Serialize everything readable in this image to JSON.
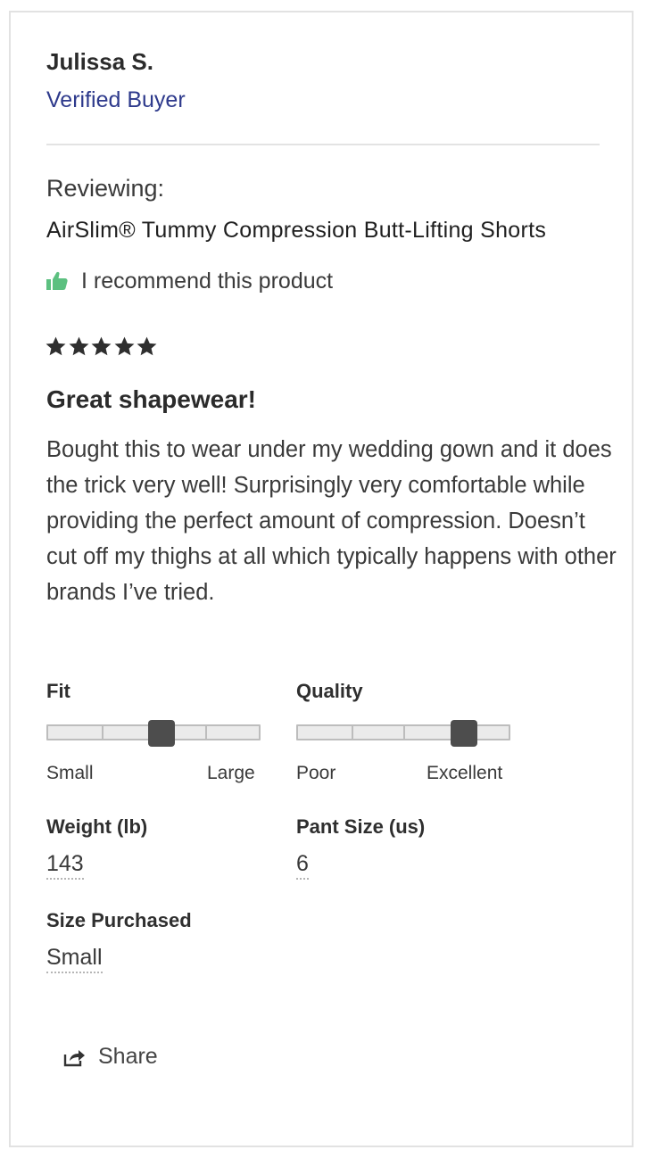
{
  "reviewer": {
    "name": "Julissa S.",
    "badge": "Verified Buyer"
  },
  "product": {
    "reviewing_label": "Reviewing:",
    "name": "AirSlim® Tummy Compression Butt-Lifting Shorts"
  },
  "recommend": {
    "icon": "thumbs-up-icon",
    "text": "I recommend this product",
    "icon_color": "#5cc080"
  },
  "rating": {
    "value": 5,
    "max": 5
  },
  "review": {
    "title": "Great shapewear!",
    "body": "Bought this to wear under my wedding gown and it does the trick very well! Surprisingly very comfortable while providing the perfect amount of compression. Doesn’t cut off my thighs at all which typically happens with other brands I’ve tried."
  },
  "fit": {
    "label": "Fit",
    "min_label": "Small",
    "max_label": "Large",
    "value_fraction": 0.54
  },
  "quality": {
    "label": "Quality",
    "min_label": "Poor",
    "max_label": "Excellent",
    "value_fraction": 0.79
  },
  "weight": {
    "label": "Weight (lb)",
    "value": "143"
  },
  "pant_size": {
    "label": "Pant Size (us)",
    "value": "6"
  },
  "size_purchased": {
    "label": "Size Purchased",
    "value": "Small"
  },
  "share": {
    "icon": "share-icon",
    "label": "Share"
  },
  "colors": {
    "accent": "#2e3a8c",
    "knob": "#4d4d4d"
  }
}
